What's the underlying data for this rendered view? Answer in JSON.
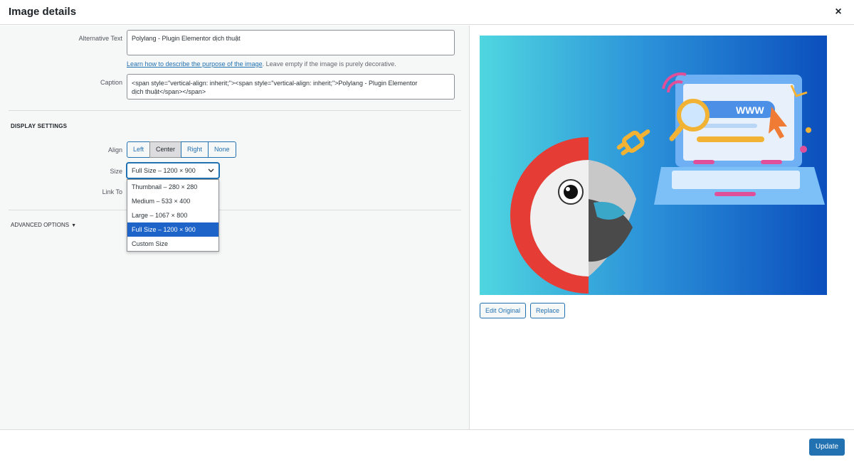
{
  "dialog": {
    "title": "Image details",
    "close_label": "×"
  },
  "fields": {
    "alt_text": {
      "label": "Alternative Text",
      "value": "Polylang - Plugin Elementor dịch thuật",
      "help_link": "Learn how to describe the purpose of the image",
      "help_rest": ". Leave empty if the image is purely decorative."
    },
    "caption": {
      "label": "Caption",
      "line1": "<span style=\"vertical-align: inherit;\"><span style=\"vertical-align: inherit;\">Polylang - Plugin Elementor",
      "line2": "dịch thuật</span></span>"
    }
  },
  "display_settings": {
    "title": "DISPLAY SETTINGS",
    "align": {
      "label": "Align",
      "options": [
        "Left",
        "Center",
        "Right",
        "None"
      ],
      "selected": "Center"
    },
    "size": {
      "label": "Size",
      "value": "Full Size – 1200 × 900",
      "options": [
        "Thumbnail – 280 × 280",
        "Medium – 533 × 400",
        "Large – 1067 × 800",
        "Full Size – 1200 × 900",
        "Custom Size"
      ],
      "selected_index": 3
    },
    "link_to": {
      "label": "Link To"
    }
  },
  "advanced": {
    "label": "ADVANCED OPTIONS",
    "toggle_glyph": "▼"
  },
  "preview": {
    "url_text": "WWW",
    "edit_original_label": "Edit Original",
    "replace_label": "Replace"
  },
  "footer": {
    "update_label": "Update"
  },
  "colors": {
    "accent": "#2271b1",
    "selected_option": "#1e64c8",
    "image_gradient_start": "#4fd6e0",
    "image_gradient_end": "#0b4fbd"
  }
}
